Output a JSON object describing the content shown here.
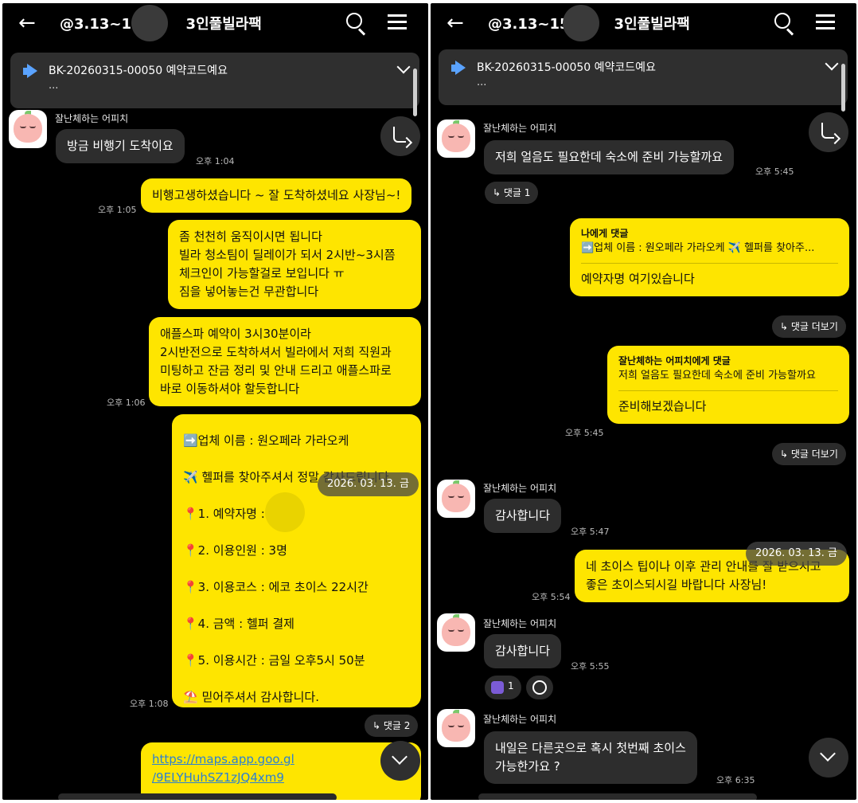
{
  "left": {
    "title": "@3.13~15",
    "title_suffix": "3인풀빌라팩",
    "notice": {
      "text": "BK-20260315-00050 예약코드예요",
      "sub": "..."
    },
    "messages": {
      "m1": {
        "sender": "잘난체하는 어피치",
        "text": "방금 비행기 도착이요",
        "time": "오후 1:04"
      },
      "m2": {
        "text": "비행고생하셨습니다 ~ 잘 도착하셨네요 사장님~!",
        "time": "오후 1:05"
      },
      "m3": {
        "lines": [
          "좀 천천히 움직이시면 됩니다",
          "빌라 청소팀이 딜레이가 되서 2시반~3시쯤",
          "체크인이 가능할걸로 보입니다 ㅠ",
          "짐을 넣어놓는건 무관합니다"
        ]
      },
      "m4": {
        "lines": [
          "애플스파 예약이 3시30분이라",
          "2시반전으로 도착하셔서 빌라에서 저희 직원과",
          "미팅하고 잔금 정리 및 안내 드리고 애플스파로",
          "바로 이동하셔야 할듯합니다"
        ],
        "time": "오후 1:06"
      },
      "m5": {
        "lines": [
          "➡️업체 이름 : 원오페라 가라오케",
          "✈️ 헬퍼를 찾아주셔서 정말 감사드립니다.",
          "📍1. 예약자명 : 헬퍼",
          "📍2. 이용인원 :  3명",
          "📍3. 이용코스 :  에코 초이스 22시간",
          "📍4. 금액 : 헬퍼 결제",
          "📍5. 이용시간 : 금일 오후5시 50분",
          "⛱️ 믿어주셔서 감사합니다."
        ],
        "time": "오후 1:08",
        "reply_count": "댓글 2"
      },
      "m6": {
        "link1": "https://maps.app.goo.gl",
        "link2": "/9ELYHuhSZ1zJQ4xm9"
      }
    },
    "date_pill": "2026. 03. 13. 금"
  },
  "right": {
    "title": "@3.13~15",
    "title_suffix": "3인풀빌라팩",
    "notice": {
      "text": "BK-20260315-00050 예약코드예요",
      "sub": "..."
    },
    "messages": {
      "r1": {
        "sender": "잘난체하는 어피치",
        "text": "저희 얼음도 필요한데 숙소에 준비 가능할까요",
        "time": "오후 5:45",
        "reply_count": "댓글 1"
      },
      "r2": {
        "label": "나에게 댓글",
        "quote": "➡️업체 이름 : 원오페라 가라오케  ✈️ 헬퍼를 찾아주...",
        "text": "예약자명 여기있습니다",
        "more": "댓글 더보기"
      },
      "r3": {
        "label": "잘난체하는 어피치에게 댓글",
        "quote": "저희 얼음도 필요한데 숙소에 준비 가능할까요",
        "text": "준비해보겠습니다",
        "time": "오후 5:45",
        "more": "댓글 더보기"
      },
      "r4": {
        "sender": "잘난체하는 어피치",
        "text": "감사합니다",
        "time": "오후 5:47"
      },
      "r5": {
        "lines": [
          "네 초이스 팁이나 이후 관리 안내를 잘 받으시고",
          "좋은 초이스되시길 바랍니다 사장님!"
        ],
        "time": "오후 5:54"
      },
      "r6": {
        "sender": "잘난체하는 어피치",
        "text": "감사합니다",
        "time": "오후 5:55",
        "reaction_count": "1"
      },
      "r7": {
        "sender": "잘난체하는 어피치",
        "lines": [
          "내일은 다른곳으로 혹시 첫번째 초이스",
          "가능한가요 ?"
        ],
        "time": "오후 6:35"
      }
    },
    "date_pill": "2026. 03. 13. 금"
  },
  "icons": {
    "back": "back-arrow-icon",
    "search": "search-icon",
    "menu": "menu-icon",
    "notice": "megaphone-icon",
    "share": "share-icon",
    "scroll_down": "chevron-down-icon"
  }
}
